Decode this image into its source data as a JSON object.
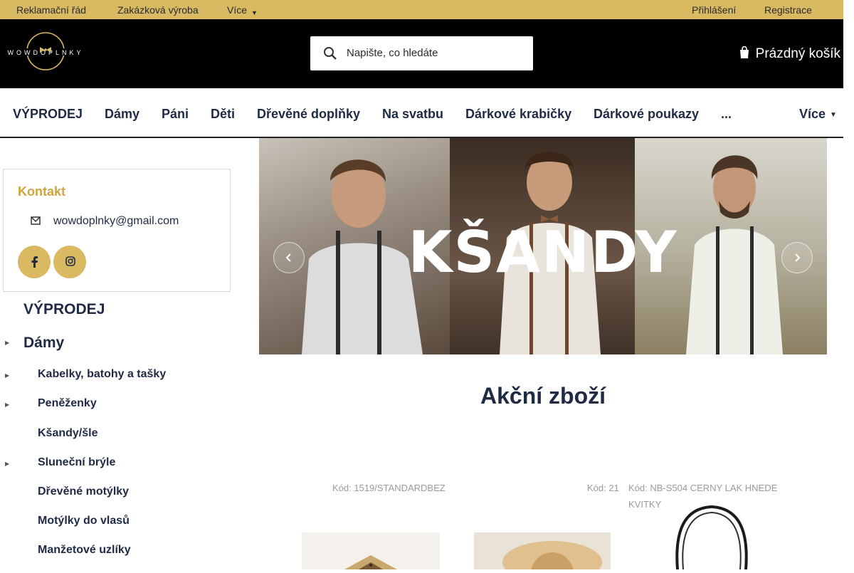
{
  "topbar": {
    "links": [
      "Reklamační řád",
      "Zakázková výroba",
      "Více"
    ],
    "login": "Přihlášení",
    "register": "Registrace"
  },
  "header": {
    "logo_text": "WOWDOPLNKY",
    "search_placeholder": "Napište, co hledáte",
    "cart_label": "Prázdný košík"
  },
  "menu": {
    "items": [
      "VÝPRODEJ",
      "Dámy",
      "Páni",
      "Děti",
      "Dřevěné doplňky",
      "Na svatbu",
      "Dárkové krabičky",
      "Dárkové poukazy",
      "...",
      "Více"
    ]
  },
  "sidebar": {
    "contact_title": "Kontakt",
    "email": "wowdoplnky@gmail.com",
    "social": [
      "facebook-icon",
      "instagram-icon"
    ],
    "categories": [
      {
        "label": "VÝPRODEJ",
        "level": 1,
        "expandable": false
      },
      {
        "label": "Dámy",
        "level": 1,
        "expandable": true
      },
      {
        "label": "Kabelky, batohy a tašky",
        "level": 2,
        "expandable": true
      },
      {
        "label": "Peněženky",
        "level": 2,
        "expandable": true
      },
      {
        "label": "Kšandy/šle",
        "level": 2,
        "expandable": false
      },
      {
        "label": "Sluneční brýle",
        "level": 2,
        "expandable": true
      },
      {
        "label": "Dřevěné motýlky",
        "level": 2,
        "expandable": false
      },
      {
        "label": "Motýlky do vlasů",
        "level": 2,
        "expandable": false
      },
      {
        "label": "Manžetové uzlíky",
        "level": 2,
        "expandable": false
      }
    ]
  },
  "banner": {
    "title": "KŠANDY"
  },
  "main": {
    "section_title": "Akční zboží",
    "products": [
      {
        "code": "Kód: 1519/STANDARDBEZ"
      },
      {
        "code": "Kód: 21"
      },
      {
        "code_line1": "Kód: NB-S504 CERNY LAK HNEDE",
        "code_line2": "KVITKY"
      }
    ]
  },
  "colors": {
    "accent": "#d9ba62",
    "header_bg": "#000000",
    "text": "#1f2a44",
    "contact_title": "#d1a53c"
  }
}
